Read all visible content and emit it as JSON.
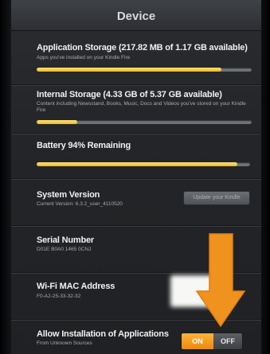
{
  "header": {
    "title": "Device"
  },
  "app_storage": {
    "label": "Application Storage (217.82 MB of 1.17 GB available)",
    "subtitle": "Apps you've installed on your Kindle Fire",
    "fill_fraction": 0.86
  },
  "internal_storage": {
    "label": "Internal Storage (4.33 GB of 5.37 GB available)",
    "subtitle": "Content including Newsstand, Books, Music, Docs and Videos you've stored on your Kindle Fire",
    "fill_fraction": 0.19
  },
  "battery": {
    "label": "Battery 94% Remaining",
    "fill_fraction": 0.94
  },
  "system_version": {
    "label": "System Version",
    "subtitle": "Current Version: 6.3.2_user_4110520",
    "button_label": "Update your Kindle"
  },
  "serial_number": {
    "label": "Serial Number",
    "value": "D01E B0A0 1465 0CNJ"
  },
  "wifi_mac": {
    "label": "Wi-Fi MAC Address",
    "value": "F0-A2-25-33-32-32"
  },
  "unknown_sources": {
    "label": "Allow Installation of Applications",
    "subtitle": "From Unknown Sources",
    "on_label": "ON",
    "off_label": "OFF",
    "selected": "ON"
  },
  "colors": {
    "bar_fill": "#f2b81c",
    "toggle_on": "#f29a17",
    "arrow": "#f0921e"
  },
  "icons": {
    "annotation": "down-arrow-icon"
  }
}
